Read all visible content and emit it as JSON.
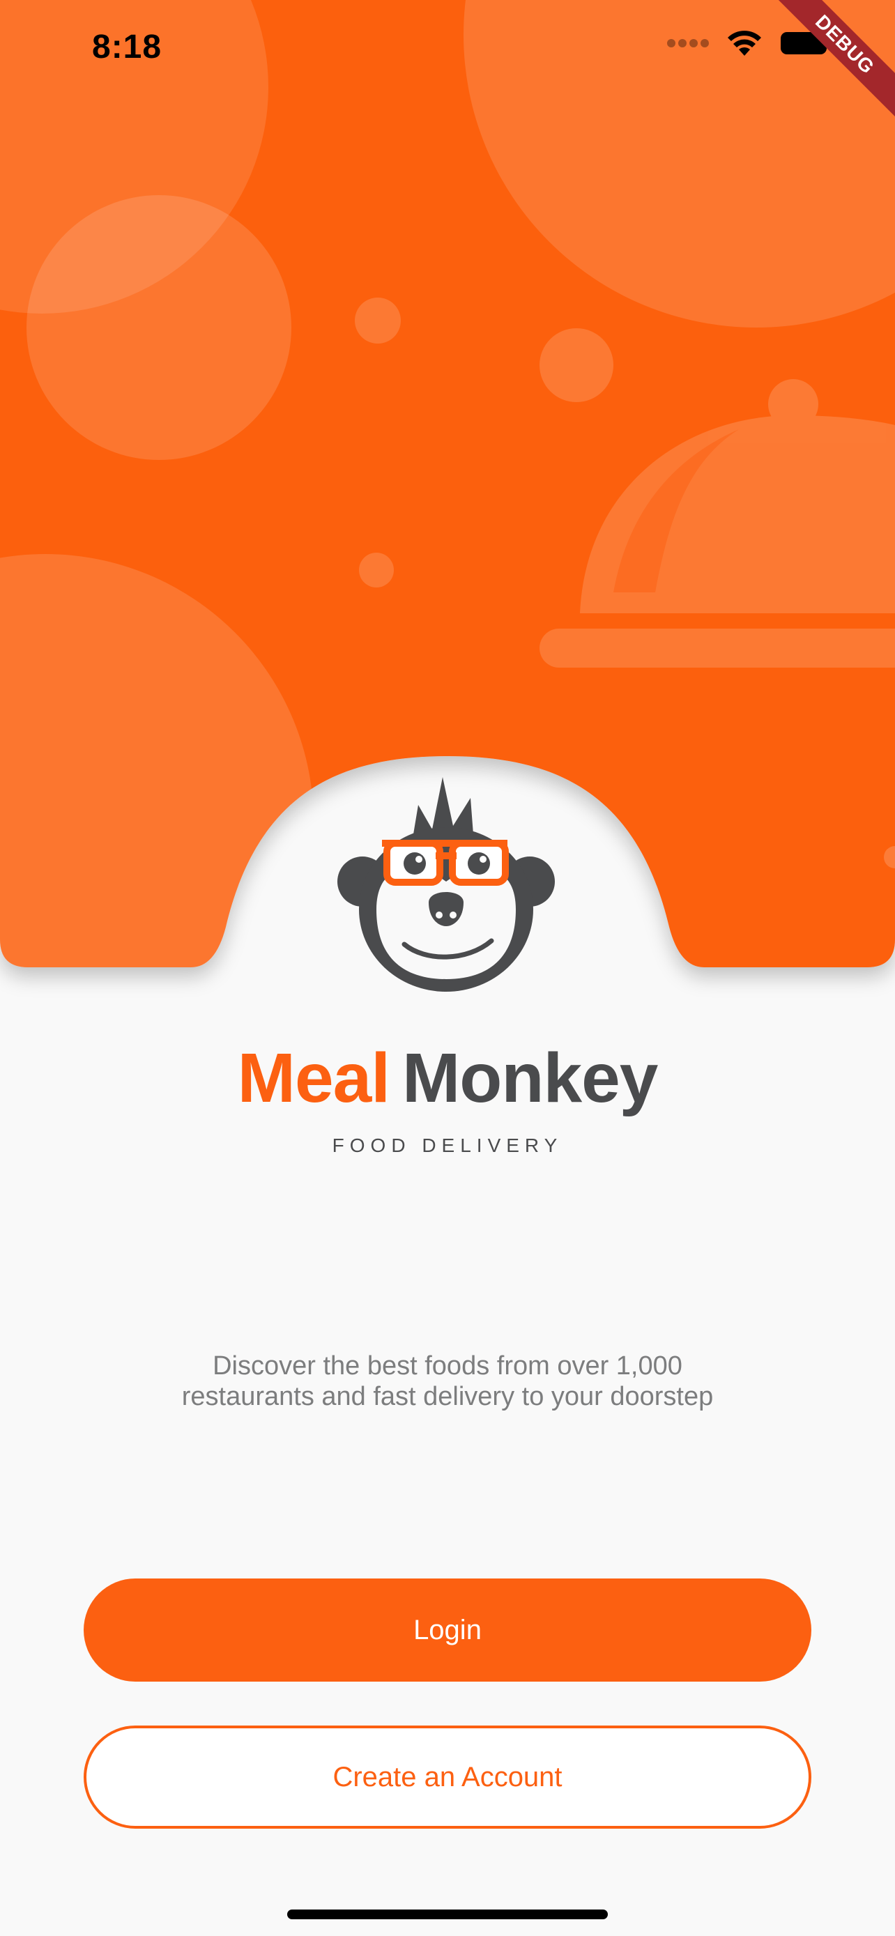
{
  "status_bar": {
    "time": "8:18"
  },
  "debug_banner": {
    "label": "DEBUG"
  },
  "brand": {
    "name_primary": "Meal",
    "name_secondary": "Monkey",
    "tagline": "FOOD DELIVERY"
  },
  "intro": {
    "description_line1": "Discover the best foods from over 1,000",
    "description_line2": "restaurants and fast delivery to your doorstep"
  },
  "actions": {
    "login_label": "Login",
    "create_account_label": "Create an Account"
  },
  "colors": {
    "accent": "#fc6011",
    "text_primary": "#4a4b4d",
    "text_secondary": "#7c7d7e",
    "background": "#f9f9f9"
  }
}
